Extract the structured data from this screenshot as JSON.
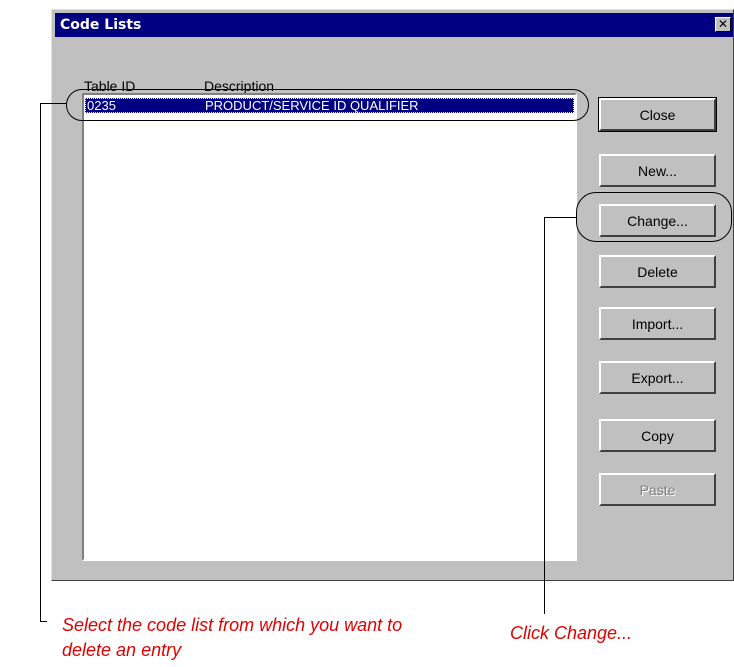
{
  "window": {
    "title": "Code Lists",
    "close_glyph": "✕"
  },
  "columns": {
    "table_id": "Table ID",
    "description": "Description"
  },
  "rows": [
    {
      "table_id": "0235",
      "description": "PRODUCT/SERVICE ID QUALIFIER",
      "selected": true
    }
  ],
  "buttons": {
    "close": "Close",
    "new": "New...",
    "change": "Change...",
    "delete": "Delete",
    "import": "Import...",
    "export": "Export...",
    "copy": "Copy",
    "paste": "Paste"
  },
  "annotations": {
    "select_line1": "Select the code list from which you want to",
    "select_line2": "delete an entry",
    "change": "Click Change..."
  },
  "colors": {
    "titlebar": "#000080",
    "dialog_face": "#c0c0c0",
    "selection": "#000080",
    "annotation_text": "#e00000"
  }
}
